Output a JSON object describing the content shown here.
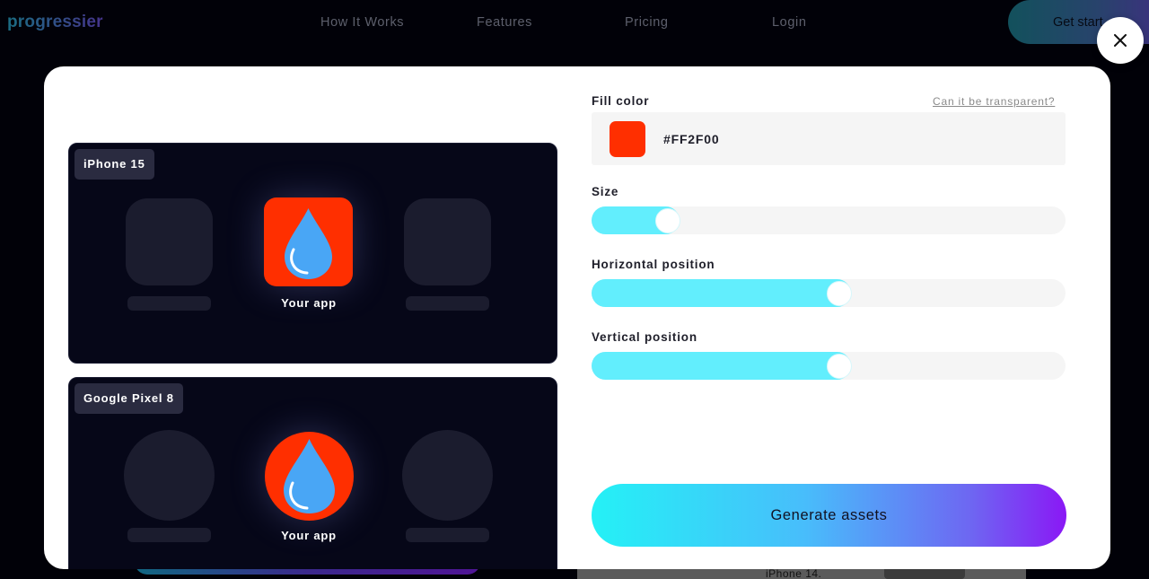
{
  "nav": {
    "logo": "progressier",
    "links": [
      "How It Works",
      "Features",
      "Pricing",
      "Login"
    ],
    "cta": "Get start"
  },
  "background": {
    "peek_text": "iPhone 14."
  },
  "modal": {
    "close_icon": "close-icon",
    "previews": [
      {
        "device": "iPhone 15",
        "app_label": "Your app",
        "icon_shape": "rounded-square"
      },
      {
        "device": "Google Pixel 8",
        "app_label": "Your app",
        "icon_shape": "circle"
      }
    ],
    "fill_color": {
      "label": "Fill color",
      "help_link": "Can it be transparent?",
      "value": "#FF2F00"
    },
    "sliders": [
      {
        "label": "Size",
        "value_fraction": 0.16
      },
      {
        "label": "Horizontal position",
        "value_fraction": 0.52
      },
      {
        "label": "Vertical position",
        "value_fraction": 0.52
      }
    ],
    "generate_button": "Generate assets"
  },
  "colors": {
    "accent_fill": "#FF2F00",
    "slider_fill": "#62EEFD",
    "drop_blue": "#49A6F5"
  }
}
